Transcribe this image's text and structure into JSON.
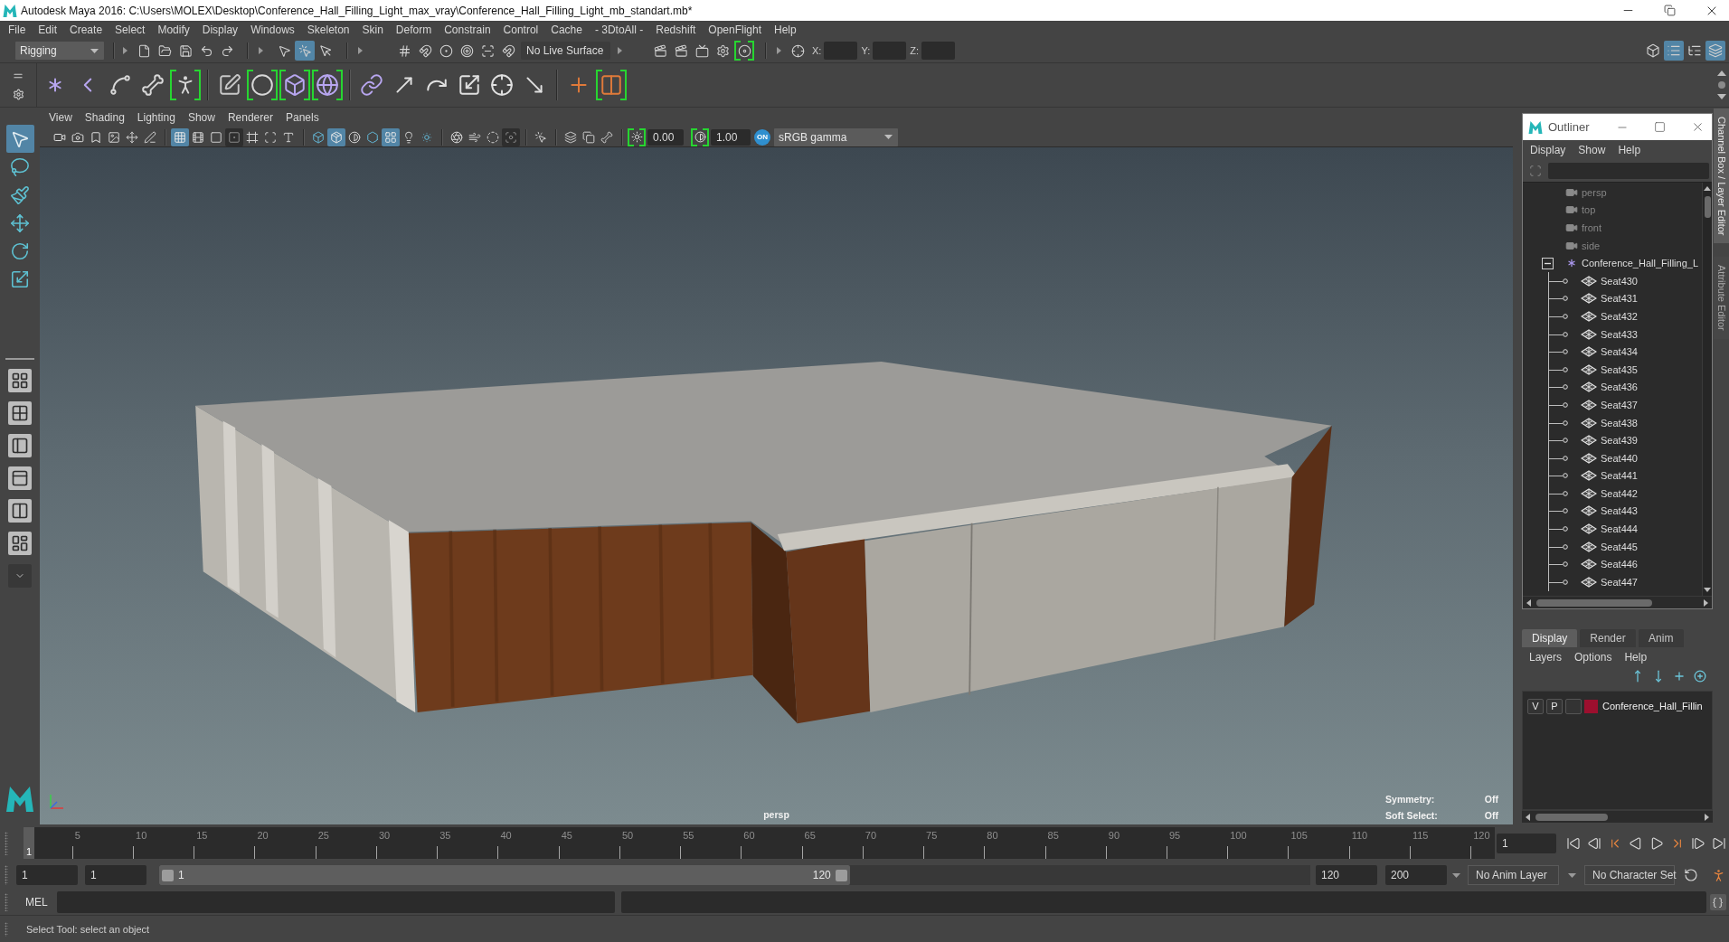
{
  "window": {
    "title": "Autodesk Maya 2016: C:\\Users\\MOLEX\\Desktop\\Conference_Hall_Filling_Light_max_vray\\Conference_Hall_Filling_Light_mb_standart.mb*"
  },
  "menu_bar": [
    "File",
    "Edit",
    "Create",
    "Select",
    "Modify",
    "Display",
    "Windows",
    "Skeleton",
    "Skin",
    "Deform",
    "Constrain",
    "Control",
    "Cache",
    "- 3DtoAll -",
    "Redshift",
    "OpenFlight",
    "Help"
  ],
  "status_line": {
    "menu_set": "Rigging",
    "selection_modes": [
      {
        "selected": false
      },
      {
        "selected": true
      },
      {
        "selected": false
      }
    ],
    "live_surface": "No Live Surface",
    "coordinates": [
      "X:",
      "Y:",
      "Z:"
    ],
    "panel_toggles": [
      {
        "on": false
      },
      {
        "on": true
      },
      {
        "on": false
      },
      {
        "on": true
      }
    ]
  },
  "toolbox": {
    "tools": [
      {
        "selected": true
      },
      {
        "selected": false
      },
      {
        "selected": false
      },
      {
        "selected": false
      },
      {
        "selected": false
      },
      {
        "selected": false
      }
    ]
  },
  "viewport": {
    "menu": [
      "View",
      "Shading",
      "Lighting",
      "Show",
      "Renderer",
      "Panels"
    ],
    "toggles": [
      {
        "on": false
      },
      {
        "on": false
      },
      {
        "on": false
      },
      {
        "on": false
      },
      {
        "on": false
      },
      {
        "on": false
      },
      {
        "on": true
      },
      {
        "on": false
      },
      {
        "on": false
      },
      {
        "on": false
      },
      {
        "on": false
      },
      {
        "on": false
      },
      {
        "on": false
      },
      {
        "on": false
      },
      {
        "on": true
      },
      {
        "on": false
      },
      {
        "on": false
      },
      {
        "on": true
      },
      {
        "on": false
      },
      {
        "on": false
      },
      {
        "on": false
      },
      {
        "on": false
      },
      {
        "on": false
      },
      {
        "on": false
      },
      {
        "on": false
      },
      {
        "on": false
      },
      {
        "on": false
      },
      {
        "on": false
      }
    ],
    "exposure": "0.00",
    "gamma": "1.00",
    "color_management": "ON",
    "color_space": "sRGB gamma",
    "camera": "persp",
    "hud": [
      {
        "label": "Symmetry:",
        "value": "Off"
      },
      {
        "label": "Soft Select:",
        "value": "Off"
      }
    ]
  },
  "outliner": {
    "title": "Outliner",
    "menu": [
      "Display",
      "Show",
      "Help"
    ],
    "items": [
      {
        "label": "persp",
        "kind": "camera",
        "dimmed": true,
        "expanded": false
      },
      {
        "label": "top",
        "kind": "camera",
        "dimmed": true,
        "expanded": false
      },
      {
        "label": "front",
        "kind": "camera",
        "dimmed": true,
        "expanded": false
      },
      {
        "label": "side",
        "kind": "camera",
        "dimmed": true,
        "expanded": false
      },
      {
        "label": "Conference_Hall_Filling_L",
        "kind": "group",
        "dimmed": false,
        "expanded": true,
        "children": [
          {
            "label": "Seat430",
            "kind": "mesh",
            "dimmed": false
          },
          {
            "label": "Seat431",
            "kind": "mesh",
            "dimmed": false
          },
          {
            "label": "Seat432",
            "kind": "mesh",
            "dimmed": false
          },
          {
            "label": "Seat433",
            "kind": "mesh",
            "dimmed": false
          },
          {
            "label": "Seat434",
            "kind": "mesh",
            "dimmed": false
          },
          {
            "label": "Seat435",
            "kind": "mesh",
            "dimmed": false
          },
          {
            "label": "Seat436",
            "kind": "mesh",
            "dimmed": false
          },
          {
            "label": "Seat437",
            "kind": "mesh",
            "dimmed": false
          },
          {
            "label": "Seat438",
            "kind": "mesh",
            "dimmed": false
          },
          {
            "label": "Seat439",
            "kind": "mesh",
            "dimmed": false
          },
          {
            "label": "Seat440",
            "kind": "mesh",
            "dimmed": false
          },
          {
            "label": "Seat441",
            "kind": "mesh",
            "dimmed": false
          },
          {
            "label": "Seat442",
            "kind": "mesh",
            "dimmed": false
          },
          {
            "label": "Seat443",
            "kind": "mesh",
            "dimmed": false
          },
          {
            "label": "Seat444",
            "kind": "mesh",
            "dimmed": false
          },
          {
            "label": "Seat445",
            "kind": "mesh",
            "dimmed": false
          },
          {
            "label": "Seat446",
            "kind": "mesh",
            "dimmed": false
          },
          {
            "label": "Seat447",
            "kind": "mesh",
            "dimmed": false
          }
        ]
      }
    ]
  },
  "side_tabs": [
    {
      "label": "Channel Box / Layer Editor",
      "selected": true
    },
    {
      "label": "Attribute Editor",
      "selected": false
    }
  ],
  "layer_editor": {
    "tabs": [
      {
        "label": "Display",
        "selected": true
      },
      {
        "label": "Render",
        "selected": false
      },
      {
        "label": "Anim",
        "selected": false
      }
    ],
    "menu": [
      "Layers",
      "Options",
      "Help"
    ],
    "layers": [
      {
        "visibility": "V",
        "playback": "P",
        "name": "Conference_Hall_Fillin",
        "color": "#9c0f2e"
      }
    ]
  },
  "timeline": {
    "current_frame": "1",
    "ticks": [
      "5",
      "10",
      "15",
      "20",
      "25",
      "30",
      "35",
      "40",
      "45",
      "50",
      "55",
      "60",
      "65",
      "70",
      "75",
      "80",
      "85",
      "90",
      "95",
      "100",
      "105",
      "110",
      "115",
      "120"
    ],
    "frame_field": "1"
  },
  "range_slider": {
    "start": "1",
    "playback_start": "1",
    "range_start": "1",
    "range_end": "120",
    "level": 0.6,
    "playback_end": "120",
    "end": "200"
  },
  "anim_layer": "No Anim Layer",
  "character_set": "No Character Set",
  "command_line": {
    "language": "MEL"
  },
  "help_line": "Select Tool: select an object"
}
